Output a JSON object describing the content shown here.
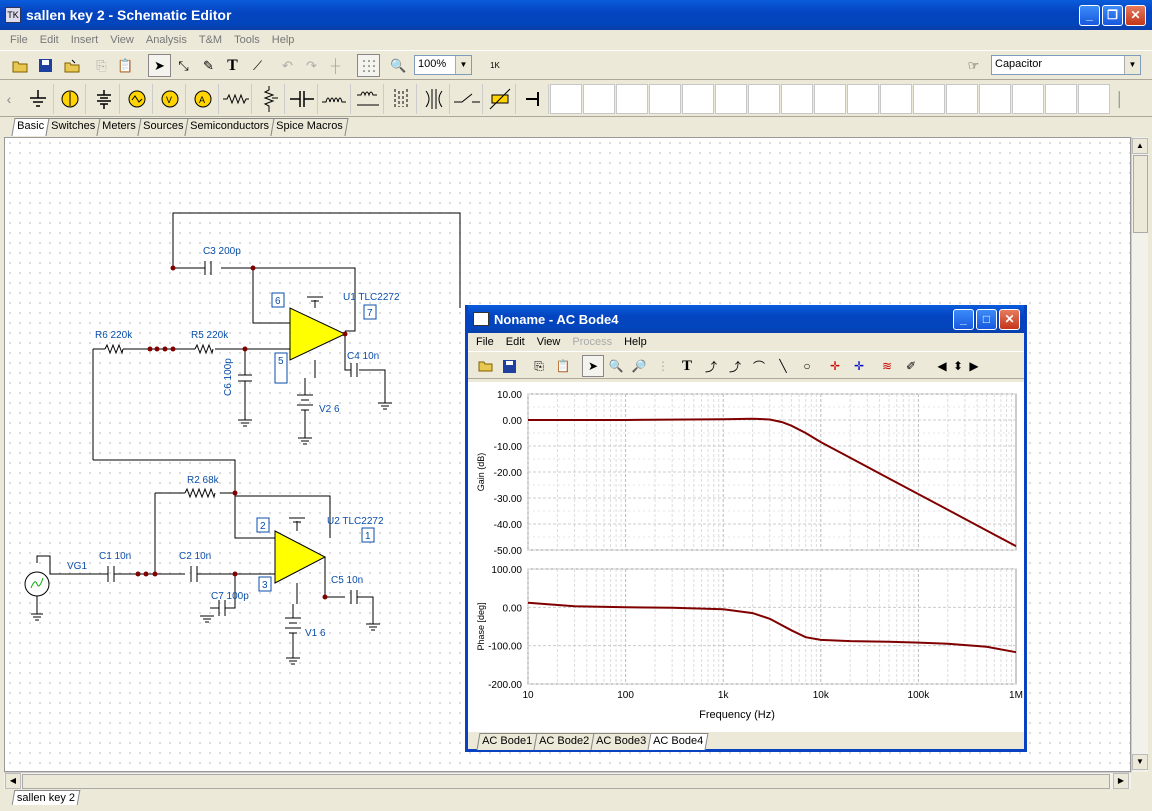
{
  "window": {
    "title": "sallen key 2 - Schematic Editor",
    "icon_letters": "TK"
  },
  "menu": [
    "File",
    "Edit",
    "Insert",
    "View",
    "Analysis",
    "T&M",
    "Tools",
    "Help"
  ],
  "toolbar": {
    "zoom": "100%",
    "component": "Capacitor",
    "meter_label": "1K"
  },
  "component_tabs": [
    "Basic",
    "Switches",
    "Meters",
    "Sources",
    "Semiconductors",
    "Spice Macros"
  ],
  "active_component_tab": "Basic",
  "document_tabs": [
    "sallen key 2"
  ],
  "schematic": {
    "labels": {
      "c3": "C3 200p",
      "u1": "U1 TLC2272",
      "u1_pin7": "7",
      "u1_pin6": "6",
      "u1_pin5": "5",
      "r6": "R6 220k",
      "r5": "R5 220k",
      "c6": "C6 100p",
      "c4": "C4 10n",
      "v2": "V2 6",
      "r2": "R2 68k",
      "u2": "U2 TLC2272",
      "u2_pin2": "2",
      "u2_pin1": "1",
      "u2_pin3": "3",
      "vg1": "VG1",
      "c1": "C1 10n",
      "c2": "C2 10n",
      "c5": "C5 10n",
      "c7": "C7 100p",
      "v1": "V1 6"
    }
  },
  "bode": {
    "title": "Noname - AC Bode4",
    "menu": [
      "File",
      "Edit",
      "View",
      "Process",
      "Help"
    ],
    "disabled_menu": "Process",
    "tabs": [
      "AC Bode1",
      "AC Bode2",
      "AC Bode3",
      "AC Bode4"
    ],
    "active_tab": "AC Bode4"
  },
  "chart_data": [
    {
      "type": "line",
      "ylabel": "Gain (dB)",
      "xlabel": "",
      "xscale": "log",
      "xlim": [
        10,
        1000000
      ],
      "ylim": [
        -50,
        10
      ],
      "yticks": [
        "10.00",
        "0.00",
        "-10.00",
        "-20.00",
        "-30.00",
        "-40.00",
        "-50.00"
      ],
      "grid": true,
      "series": [
        {
          "color": "#800000",
          "x": [
            10,
            100,
            1000,
            2000,
            3000,
            4000,
            5000,
            7000,
            10000,
            20000,
            50000,
            100000,
            200000,
            500000,
            1000000
          ],
          "y": [
            0,
            0,
            0.3,
            0.5,
            0.2,
            -0.8,
            -2.2,
            -5.0,
            -8.5,
            -14.5,
            -22.5,
            -28.5,
            -34.5,
            -42.5,
            -48.5
          ]
        }
      ]
    },
    {
      "type": "line",
      "ylabel": "Phase [deg]",
      "xlabel": "Frequency (Hz)",
      "xscale": "log",
      "xlim": [
        10,
        1000000
      ],
      "ylim": [
        -200,
        100
      ],
      "yticks": [
        "100.00",
        "0.00",
        "-100.00",
        "-200.00"
      ],
      "xticks": [
        "10",
        "100",
        "1k",
        "10k",
        "100k",
        "1M"
      ],
      "grid": true,
      "series": [
        {
          "color": "#800000",
          "x": [
            10,
            30,
            100,
            300,
            1000,
            2000,
            3000,
            5000,
            7000,
            10000,
            20000,
            50000,
            100000,
            200000,
            500000,
            1000000
          ],
          "y": [
            12,
            3,
            0,
            -1,
            -5,
            -15,
            -30,
            -60,
            -78,
            -85,
            -88,
            -90,
            -92,
            -95,
            -103,
            -117
          ]
        }
      ]
    }
  ]
}
